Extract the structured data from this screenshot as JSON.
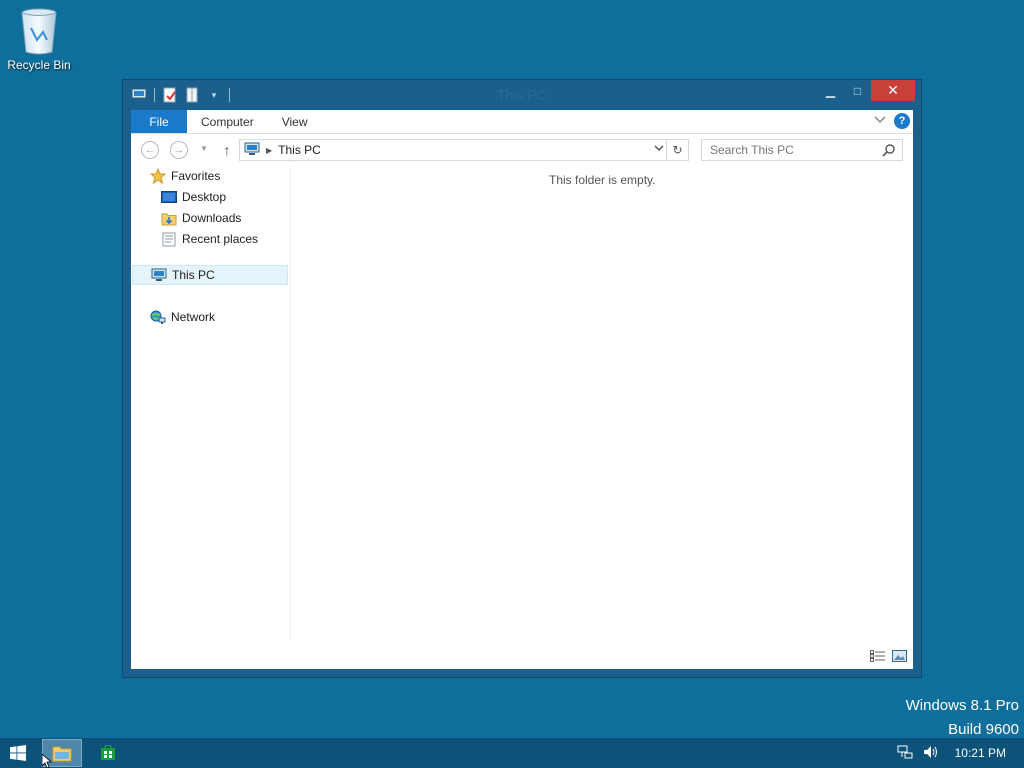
{
  "desktop": {
    "recycle_bin_label": "Recycle Bin",
    "watermark_line1": "Windows 8.1 Pro",
    "watermark_line2": "Build 9600"
  },
  "window": {
    "title": "This PC",
    "ribbon_tabs": [
      {
        "label": "File"
      },
      {
        "label": "Computer"
      },
      {
        "label": "View"
      }
    ],
    "address_path": "This PC",
    "search_placeholder": "Search This PC",
    "nav": {
      "favorites": "Favorites",
      "desktop": "Desktop",
      "downloads": "Downloads",
      "recent_places": "Recent places",
      "this_pc": "This PC",
      "network": "Network"
    },
    "empty_message": "This folder is empty."
  },
  "taskbar": {
    "clock": "10:21 PM"
  },
  "colors": {
    "desktop_bg": "#0f6f9c",
    "window_frame": "#1b5f8c",
    "accent": "#1979ca",
    "close_button": "#c7403a",
    "taskbar": "#0d5279"
  }
}
